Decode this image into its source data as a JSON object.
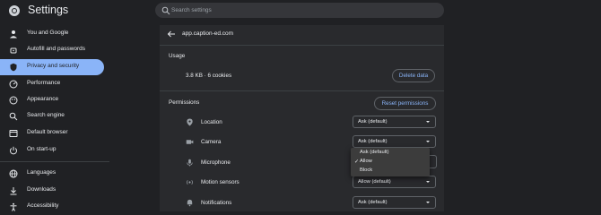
{
  "app": {
    "title": "Settings",
    "logo_icon": "chrome-logo-icon"
  },
  "search": {
    "placeholder": "Search settings"
  },
  "sidebar": {
    "items": [
      {
        "label": "You and Google",
        "icon": "person-icon",
        "active": false
      },
      {
        "label": "Autofill and passwords",
        "icon": "key-icon",
        "active": false
      },
      {
        "label": "Privacy and security",
        "icon": "shield-icon",
        "active": true
      },
      {
        "label": "Performance",
        "icon": "speedometer-icon",
        "active": false
      },
      {
        "label": "Appearance",
        "icon": "palette-icon",
        "active": false
      },
      {
        "label": "Search engine",
        "icon": "search-icon",
        "active": false
      },
      {
        "label": "Default browser",
        "icon": "browser-icon",
        "active": false
      },
      {
        "label": "On start-up",
        "icon": "power-icon",
        "active": false
      },
      {
        "label": "Languages",
        "icon": "globe-icon",
        "active": false
      },
      {
        "label": "Downloads",
        "icon": "download-icon",
        "active": false
      },
      {
        "label": "Accessibility",
        "icon": "accessibility-icon",
        "active": false
      }
    ]
  },
  "site": {
    "title": "app.caption-ed.com",
    "usage_heading": "Usage",
    "usage_text": "3.8 KB · 6 cookies",
    "delete_label": "Delete data",
    "permissions_heading": "Permissions",
    "reset_label": "Reset permissions",
    "permissions": [
      {
        "label": "Location",
        "icon": "location-icon",
        "value": "Ask (default)"
      },
      {
        "label": "Camera",
        "icon": "camera-icon",
        "value": "Ask (default)"
      },
      {
        "label": "Microphone",
        "icon": "microphone-icon",
        "value": "Allow"
      },
      {
        "label": "Motion sensors",
        "icon": "motion-sensors-icon",
        "value": "Allow (default)"
      },
      {
        "label": "Notifications",
        "icon": "bell-icon",
        "value": "Ask (default)"
      }
    ]
  },
  "microphone_dropdown": {
    "options": [
      {
        "label": "Ask (default)",
        "checked": false
      },
      {
        "label": "Allow",
        "checked": true
      },
      {
        "label": "Block",
        "checked": false
      }
    ]
  },
  "colors": {
    "accent": "#8ab4f8",
    "background": "#202124",
    "card": "#292a2d"
  }
}
